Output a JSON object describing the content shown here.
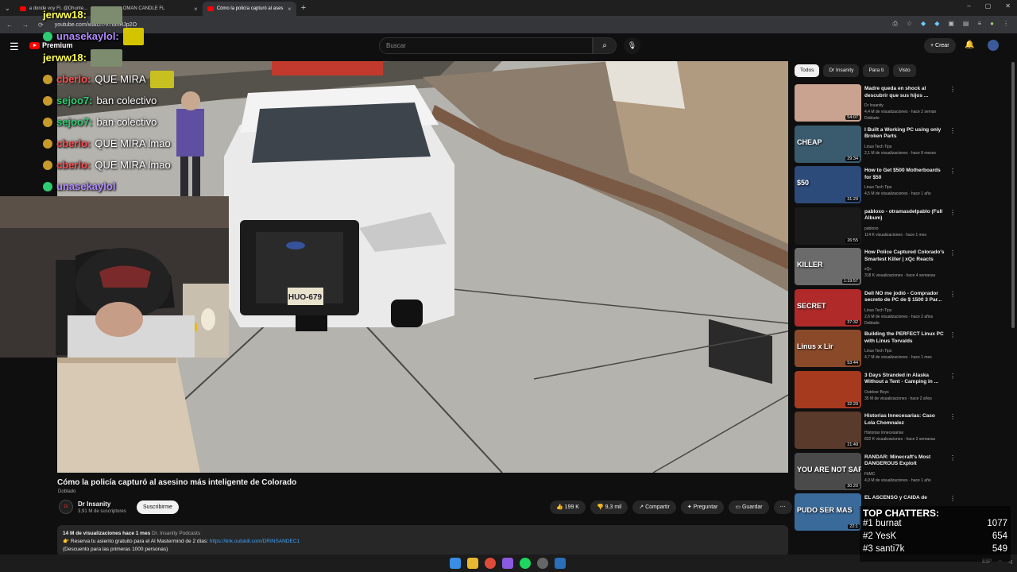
{
  "browser": {
    "tabs": [
      {
        "label": "a donde voy Ft. @Dhunte..."
      },
      {
        "label": "OMAN CANDLE FL"
      },
      {
        "label": "Cómo la policía capturó al ases"
      }
    ],
    "url": "youtube.com/watch?v=t6hRJp2O",
    "new_tab": "+",
    "window_controls": [
      "–",
      "▢",
      "✕"
    ]
  },
  "header": {
    "menu_icon": "hamburger-icon",
    "logo_text": "Premium",
    "search_placeholder": "Buscar",
    "create_label": "+ Crear"
  },
  "chat": [
    {
      "user": "jerww18:",
      "message": "",
      "user_color": "#ffff50",
      "has_thumb": true
    },
    {
      "user": "unasekaylol:",
      "message": "",
      "user_color": "#b38bff",
      "has_thumb": true
    },
    {
      "user": "jerww18:",
      "message": "",
      "user_color": "#ffff50",
      "has_thumb": true
    },
    {
      "user": "cberlo:",
      "message": "QUE MIRA",
      "user_color": "#ff5050",
      "has_thumb": true
    },
    {
      "user": "sejoo7:",
      "message": "ban colectivo",
      "user_color": "#2ecc71",
      "has_thumb": false
    },
    {
      "user": "sejoo7:",
      "message": "ban colectivo",
      "user_color": "#2ecc71",
      "has_thumb": false
    },
    {
      "user": "cberlo:",
      "message": "QUE MIRA lmao",
      "user_color": "#ff5050",
      "has_thumb": false
    },
    {
      "user": "cberlo:",
      "message": "QUE MIRA lmao",
      "user_color": "#ff5050",
      "has_thumb": false
    },
    {
      "user": "unasekaylol",
      "message": "",
      "user_color": "#b38bff",
      "has_thumb": false
    }
  ],
  "video": {
    "plate": "HUO-679",
    "title": "Cómo la policía capturó al asesino más inteligente de Colorado",
    "dubbed": "Doblado",
    "channel": "Dr Insanity",
    "subscribers": "3,91 M de suscriptores",
    "subscribe_label": "Suscribirme",
    "likes": "199 K",
    "dislikes": "9,3 mil",
    "share_label": "Compartir",
    "ask_label": "Preguntar",
    "save_label": "Guardar",
    "more_label": "⋯",
    "description": {
      "meta": "14 M de visualizaciones  hace 1 mes  ",
      "tag": "Dr. Insanity Podcasts",
      "line2_prefix": "👉 Reserva tu asiento gratuito para el AI Mastermind de 2 días: ",
      "link": "https://link.outskill.com/DRINSANDEC1",
      "line3": "(Descuento para las primeras 1000 personas)"
    }
  },
  "filters": [
    "Todos",
    "Dr Insanity",
    "Para ti",
    "Visto"
  ],
  "recommendations": [
    {
      "title": "Madre queda en shock al descubrir que sus hijos ...",
      "channel": "Dr Insanity",
      "meta": "4,4 M de visualizaciones · hace 2 seman",
      "extra": "Doblado",
      "duration": "54:07",
      "color": "#c9a38f"
    },
    {
      "title": "I Built a Working PC using only Broken Parts",
      "channel": "Linus Tech Tips",
      "meta": "2,1 M de visualizaciones · hace 8 meses",
      "extra": "",
      "duration": "29:34",
      "color": "#3a5b6e",
      "overlay": "CHEAP"
    },
    {
      "title": "How to Get $500 Motherboards for $50",
      "channel": "Linus Tech Tips",
      "meta": "4,5 M de visualizaciones · hace 1 año",
      "extra": "",
      "duration": "31:29",
      "color": "#2c4a7a",
      "overlay": "$50"
    },
    {
      "title": "pabloxo - otramasdelpablo (Full Album)",
      "channel": "pabloxo",
      "meta": "114 K visualizaciones · hace 1 mes",
      "extra": "",
      "duration": "26:55",
      "color": "#1a1a1a"
    },
    {
      "title": "How Police Captured Colorado's Smartest Killer | xQc Reacts",
      "channel": "xQc",
      "meta": "318 K visualizaciones · hace 4 semanas",
      "extra": "",
      "duration": "1:19:57",
      "color": "#6b6b6b",
      "overlay": "KILLER"
    },
    {
      "title": "Dell NO me jodió - Comprador secreto de PC de $ 1500 3 Par...",
      "channel": "Linus Tech Tips",
      "meta": "2,6 M de visualizaciones · hace 2 años",
      "extra": "Doblado",
      "duration": "37:32",
      "color": "#b02a2a",
      "overlay": "SECRET"
    },
    {
      "title": "Building the PERFECT Linux PC with Linus Torvalds",
      "channel": "Linus Tech Tips",
      "meta": "4,7 M de visualizaciones · hace 1 mes",
      "extra": "",
      "duration": "53:44",
      "color": "#8a4a2a",
      "overlay": "Linus x Lir"
    },
    {
      "title": "3 Days Stranded in Alaska Without a Tent - Camping in ...",
      "channel": "Outdoor Boys",
      "meta": "35 M de visualizaciones · hace 2 años",
      "extra": "",
      "duration": "32:29",
      "color": "#a53a1f"
    },
    {
      "title": "Historias Innecesarias: Caso Lola Chomnalez",
      "channel": "Historias Innecesarias",
      "meta": "832 K visualizaciones · hace 2 semanas",
      "extra": "",
      "duration": "21:49",
      "color": "#5a3a2a"
    },
    {
      "title": "RANDAR: Minecraft's Most DANGEROUS Exploit",
      "channel": "FitMC",
      "meta": "4,9 M de visualizaciones · hace 1 año",
      "extra": "",
      "duration": "20:20",
      "color": "#4a4a4a",
      "overlay": "YOU ARE NOT SAFE"
    },
    {
      "title": "EL ASCENSO y CAIDA de",
      "channel": "",
      "meta": "",
      "extra": "",
      "duration": "22:1",
      "color": "#3a6a9a",
      "overlay": "PUDO SER MAS"
    }
  ],
  "top_chatters": {
    "title": "TOP CHATTERS:",
    "rows": [
      {
        "rank": "#1",
        "name": "burnat",
        "count": "1077"
      },
      {
        "rank": "#2",
        "name": "YesK",
        "count": "654"
      },
      {
        "rank": "#3",
        "name": "santi7k",
        "count": "549"
      }
    ]
  },
  "taskbar": {
    "icons": [
      "windows-icon",
      "folder-icon",
      "chrome-icon",
      "app-icon",
      "spotify-icon",
      "settings-icon",
      "steam-icon"
    ],
    "tray_lang": "ESP"
  }
}
